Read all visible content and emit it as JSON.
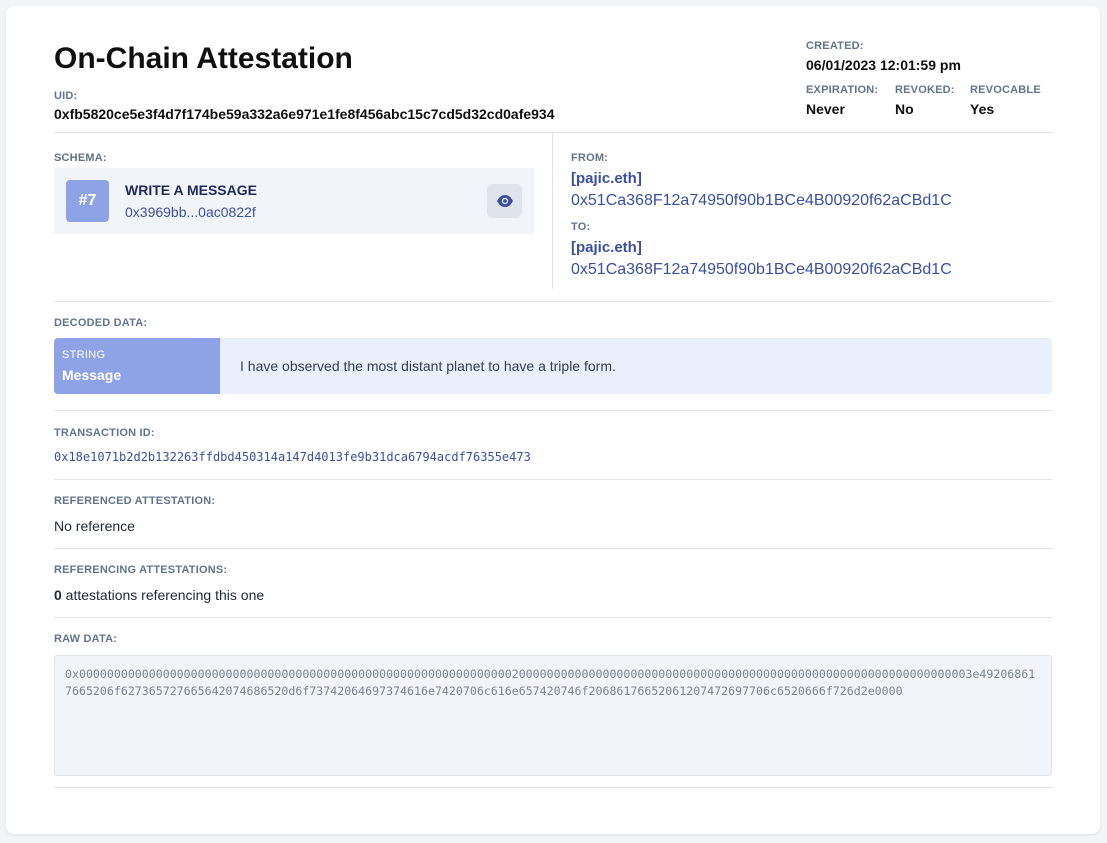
{
  "header": {
    "title": "On-Chain Attestation",
    "uid_label": "UID:",
    "uid": "0xfb5820ce5e3f4d7f174be59a332a6e971e1fe8f456abc15c7cd5d32cd0afe934"
  },
  "meta": {
    "created_label": "CREATED:",
    "created": "06/01/2023 12:01:59 pm",
    "expiration_label": "EXPIRATION:",
    "expiration": "Never",
    "revoked_label": "REVOKED:",
    "revoked": "No",
    "revocable_label": "REVOCABLE",
    "revocable": "Yes"
  },
  "schema": {
    "label": "SCHEMA:",
    "number": "#7",
    "name": "WRITE A MESSAGE",
    "address": "0x3969bb...0ac0822f",
    "view_icon": "eye-icon"
  },
  "parties": {
    "from_label": "FROM:",
    "from_ens": "[pajic.eth]",
    "from_address": "0x51Ca368F12a74950f90b1BCe4B00920f62aCBd1C",
    "to_label": "TO:",
    "to_ens": "[pajic.eth]",
    "to_address": "0x51Ca368F12a74950f90b1BCe4B00920f62aCBd1C"
  },
  "decoded": {
    "label": "DECODED DATA:",
    "type": "STRING",
    "name": "Message",
    "value": "I have observed the most distant planet to have a triple form."
  },
  "transaction": {
    "label": "TRANSACTION ID:",
    "id": "0x18e1071b2d2b132263ffdbd450314a147d4013fe9b31dca6794acdf76355e473"
  },
  "referenced": {
    "label": "REFERENCED ATTESTATION:",
    "value": "No reference"
  },
  "referencing": {
    "label": "REFERENCING ATTESTATIONS:",
    "count": "0",
    "suffix": " attestations referencing this one"
  },
  "raw": {
    "label": "RAW DATA:",
    "value": "0x00000000000000000000000000000000000000000000000000000000000000200000000000000000000000000000000000000000000000000000000000000003e492068617665206f627365727665642074686520d6f73742064697374616e7420706c616e657420746f20686176652061207472697706c6520666f726d2e0000"
  },
  "colors": {
    "accent": "#3b4fa0",
    "badge": "#8ea3e5",
    "panel": "#f1f4f9"
  }
}
